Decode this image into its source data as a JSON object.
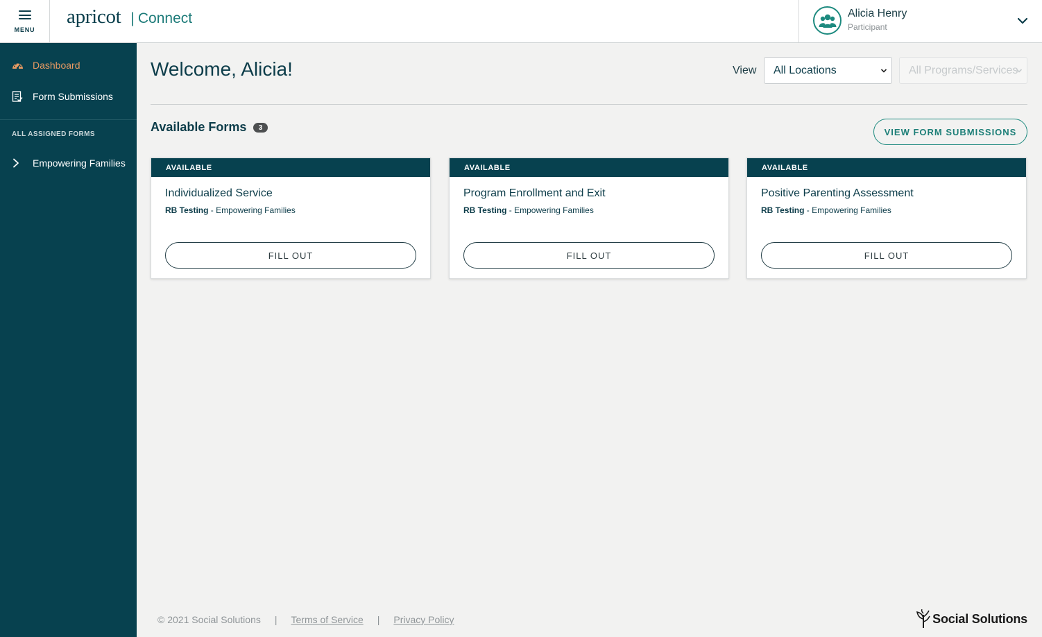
{
  "header": {
    "menu_label": "MENU",
    "brand_logo": "apricot",
    "brand_separator": "|",
    "brand_app": "Connect",
    "user_name": "Alicia Henry",
    "user_role": "Participant"
  },
  "sidebar": {
    "items": [
      {
        "label": "Dashboard",
        "icon": "dashboard-gauge-icon",
        "active": true
      },
      {
        "label": "Form Submissions",
        "icon": "form-check-icon",
        "active": false
      }
    ],
    "section_label": "ALL ASSIGNED FORMS",
    "assigned": [
      {
        "label": "Empowering Families",
        "icon": "chevron-right-icon"
      }
    ]
  },
  "main": {
    "welcome": "Welcome, Alicia!",
    "view_label": "View",
    "location_select": "All Locations",
    "program_select": "All Programs/Services",
    "available_title": "Available Forms",
    "available_count": "3",
    "view_submissions_label": "VIEW FORM SUBMISSIONS",
    "cards": [
      {
        "status": "AVAILABLE",
        "title": "Individualized Service",
        "org": "RB Testing",
        "program": " - Empowering Families",
        "button": "FILL OUT"
      },
      {
        "status": "AVAILABLE",
        "title": "Program Enrollment and Exit",
        "org": "RB Testing",
        "program": " - Empowering Families",
        "button": "FILL OUT"
      },
      {
        "status": "AVAILABLE",
        "title": "Positive Parenting Assessment",
        "org": "RB Testing",
        "program": " - Empowering Families",
        "button": "FILL OUT"
      }
    ]
  },
  "footer": {
    "copyright": "© 2021 Social Solutions",
    "separator": "|",
    "terms": "Terms of Service",
    "privacy": "Privacy Policy",
    "company_logo_text": "Social Solutions"
  },
  "colors": {
    "primary": "#07414f",
    "accent": "#1d8a7f",
    "active_nav": "#e99a62",
    "background": "#f2f2f1"
  }
}
